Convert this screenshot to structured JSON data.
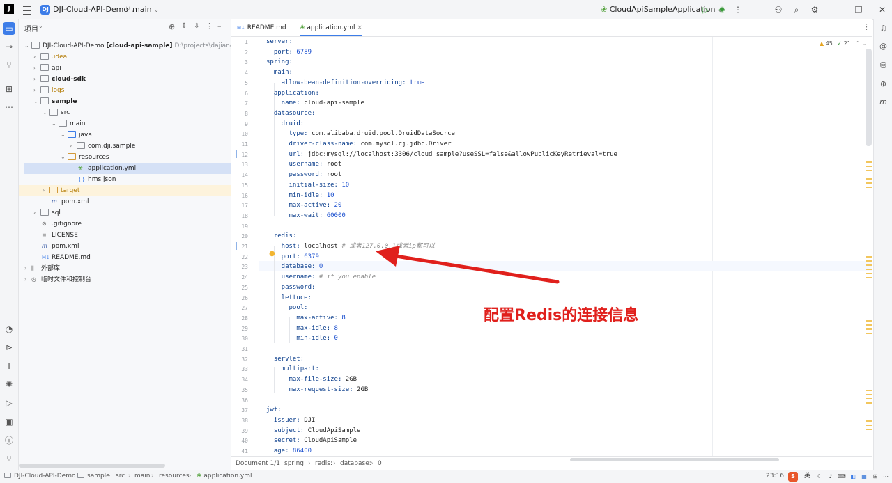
{
  "titlebar": {
    "project_badge": "DJ",
    "project_name": "DJI-Cloud-API-Demo",
    "branch": "main",
    "run_config": "CloudApiSampleApplication"
  },
  "project_panel": {
    "title": "项目",
    "items": [
      {
        "label": "DJI-Cloud-API-Demo",
        "module": "[cloud-api-sample]",
        "path": "D:\\projects\\dajiangshangyu"
      },
      {
        "label": ".idea"
      },
      {
        "label": "api"
      },
      {
        "label": "cloud-sdk"
      },
      {
        "label": "logs"
      },
      {
        "label": "sample"
      },
      {
        "label": "src"
      },
      {
        "label": "main"
      },
      {
        "label": "java"
      },
      {
        "label": "com.dji.sample"
      },
      {
        "label": "resources"
      },
      {
        "label": "application.yml"
      },
      {
        "label": "hms.json"
      },
      {
        "label": "target"
      },
      {
        "label": "pom.xml"
      },
      {
        "label": "sql"
      },
      {
        "label": ".gitignore"
      },
      {
        "label": "LICENSE"
      },
      {
        "label": "pom.xml"
      },
      {
        "label": "README.md"
      },
      {
        "label": "外部库"
      },
      {
        "label": "临时文件和控制台"
      }
    ]
  },
  "tabs": [
    {
      "label": "README.md",
      "prefix": "M↓"
    },
    {
      "label": "application.yml"
    }
  ],
  "inspections": {
    "warnings": "45",
    "ok": "21"
  },
  "annotation": "配置Redis的连接信息",
  "code": [
    {
      "n": "1",
      "k": "server:",
      "v": ""
    },
    {
      "n": "2",
      "k": "  port:",
      "v": " 6789"
    },
    {
      "n": "3",
      "k": "spring:",
      "v": ""
    },
    {
      "n": "4",
      "k": "  main:",
      "v": ""
    },
    {
      "n": "5",
      "k": "    allow-bean-definition-overriding:",
      "v": " true"
    },
    {
      "n": "6",
      "k": "  application:",
      "v": ""
    },
    {
      "n": "7",
      "k": "    name:",
      "v": " cloud-api-sample"
    },
    {
      "n": "8",
      "k": "  datasource:",
      "v": ""
    },
    {
      "n": "9",
      "k": "    druid:",
      "v": ""
    },
    {
      "n": "10",
      "k": "      type:",
      "v": " com.alibaba.druid.pool.DruidDataSource"
    },
    {
      "n": "11",
      "k": "      driver-class-name:",
      "v": " com.mysql.cj.jdbc.Driver"
    },
    {
      "n": "12",
      "k": "      url:",
      "v": " jdbc:mysql://localhost:3306/cloud_sample?useSSL=false&allowPublicKeyRetrieval=true"
    },
    {
      "n": "13",
      "k": "      username:",
      "v": " root"
    },
    {
      "n": "14",
      "k": "      password:",
      "v": " root"
    },
    {
      "n": "15",
      "k": "      initial-size:",
      "v": " 10"
    },
    {
      "n": "16",
      "k": "      min-idle:",
      "v": " 10"
    },
    {
      "n": "17",
      "k": "      max-active:",
      "v": " 20"
    },
    {
      "n": "18",
      "k": "      max-wait:",
      "v": " 60000"
    },
    {
      "n": "19",
      "k": "",
      "v": ""
    },
    {
      "n": "20",
      "k": "  redis:",
      "v": ""
    },
    {
      "n": "21",
      "k": "    host:",
      "v": " localhost",
      "c": " # 或者127.0.0.1或者ip都可以"
    },
    {
      "n": "22",
      "k": "    port:",
      "v": " 6379"
    },
    {
      "n": "23",
      "k": "    database:",
      "v": " 0"
    },
    {
      "n": "24",
      "k": "    username:",
      "v": "",
      "c": " # if you enable"
    },
    {
      "n": "25",
      "k": "    password:",
      "v": ""
    },
    {
      "n": "26",
      "k": "    lettuce:",
      "v": ""
    },
    {
      "n": "27",
      "k": "      pool:",
      "v": ""
    },
    {
      "n": "28",
      "k": "        max-active:",
      "v": " 8"
    },
    {
      "n": "29",
      "k": "        max-idle:",
      "v": " 8"
    },
    {
      "n": "30",
      "k": "        min-idle:",
      "v": " 0"
    },
    {
      "n": "31",
      "k": "",
      "v": ""
    },
    {
      "n": "32",
      "k": "  servlet:",
      "v": ""
    },
    {
      "n": "33",
      "k": "    multipart:",
      "v": ""
    },
    {
      "n": "34",
      "k": "      max-file-size:",
      "v": " 2GB"
    },
    {
      "n": "35",
      "k": "      max-request-size:",
      "v": " 2GB"
    },
    {
      "n": "36",
      "k": "",
      "v": ""
    },
    {
      "n": "37",
      "k": "jwt:",
      "v": ""
    },
    {
      "n": "38",
      "k": "  issuer:",
      "v": " DJI"
    },
    {
      "n": "39",
      "k": "  subject:",
      "v": " CloudApiSample"
    },
    {
      "n": "40",
      "k": "  secret:",
      "v": " CloudApiSample"
    },
    {
      "n": "41",
      "k": "  age:",
      "v": " 86400"
    }
  ],
  "breadcrumb": [
    "Document 1/1",
    "spring:",
    "redis:",
    "database:",
    "0"
  ],
  "statusbar": {
    "path": [
      "DJI-Cloud-API-Demo",
      "sample",
      "src",
      "main",
      "resources",
      "application.yml"
    ],
    "position": "23:16",
    "ime": "英"
  },
  "colors": {
    "accent": "#3d7de8",
    "annotation": "#e0201c"
  }
}
